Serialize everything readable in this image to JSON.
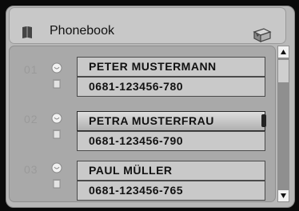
{
  "app": {
    "title": "Phonebook"
  },
  "contacts": [
    {
      "index": "01",
      "name": "PETER MUSTERMANN",
      "number": "0681-123456-780",
      "selected": false
    },
    {
      "index": "02",
      "name": "PETRA MUSTERFRAU",
      "number": "0681-123456-790",
      "selected": true
    },
    {
      "index": "03",
      "name": "PAUL MÜLLER",
      "number": "0681-123456-765",
      "selected": false
    }
  ],
  "icons": {
    "header_left": "phonebook-icon",
    "header_right": "mail-icon",
    "row_top": "smiley-icon",
    "row_bottom": "trash-icon",
    "scroll_up": "scroll-up-arrow-icon",
    "scroll_down": "scroll-down-arrow-icon"
  },
  "colors": {
    "panel": "#b8b8b8",
    "list": "#a9a9a9",
    "field": "#c9c9c9",
    "border": "#4a4a4a"
  }
}
